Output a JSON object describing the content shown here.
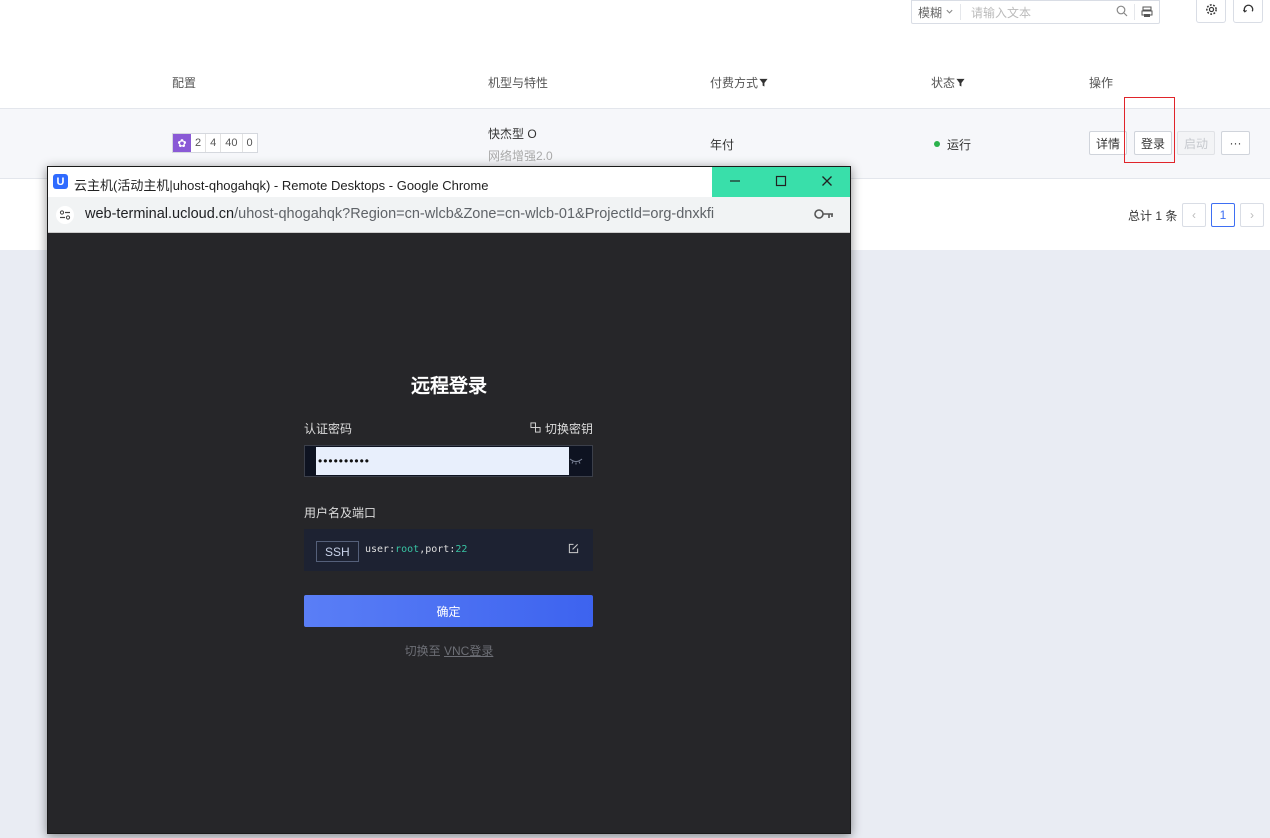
{
  "toolbar": {
    "mode": "模糊",
    "search_placeholder": "请输入文本"
  },
  "table": {
    "headers": {
      "config": "配置",
      "type": "机型与特性",
      "billing": "付费方式",
      "status": "状态",
      "actions": "操作"
    },
    "row": {
      "config_values": [
        "2",
        "4",
        "40",
        "0"
      ],
      "type_name": "快杰型 O",
      "type_feature": "网络增强2.0",
      "billing": "年付",
      "status": "运行",
      "actions": [
        "详情",
        "登录",
        "启动",
        "···"
      ]
    }
  },
  "pagination": {
    "total": "总计 1 条",
    "current": "1"
  },
  "window": {
    "title": "云主机(活动主机|uhost-qhogahqk) - Remote Desktops - Google Chrome",
    "url_host": "web-terminal.ucloud.cn",
    "url_path": "/uhost-qhogahqk?Region=cn-wlcb&Zone=cn-wlcb-01&ProjectId=org-dnxkfi"
  },
  "login": {
    "title": "远程登录",
    "password_label": "认证密码",
    "switch_key": "切换密钥",
    "password_mask": "••••••••••",
    "user_port_label": "用户名及端口",
    "protocol": "SSH",
    "user_key": "user",
    "user_value": "root",
    "port_key": "port",
    "port_value": "22",
    "confirm": "确定",
    "vnc_prefix": "切换至",
    "vnc_link": "VNC登录"
  },
  "colors": {
    "accent": "#3d63ef",
    "titlebar_controls": "#39dfaa",
    "highlight_box": "#e0242a",
    "status_running": "#2bb24c"
  }
}
